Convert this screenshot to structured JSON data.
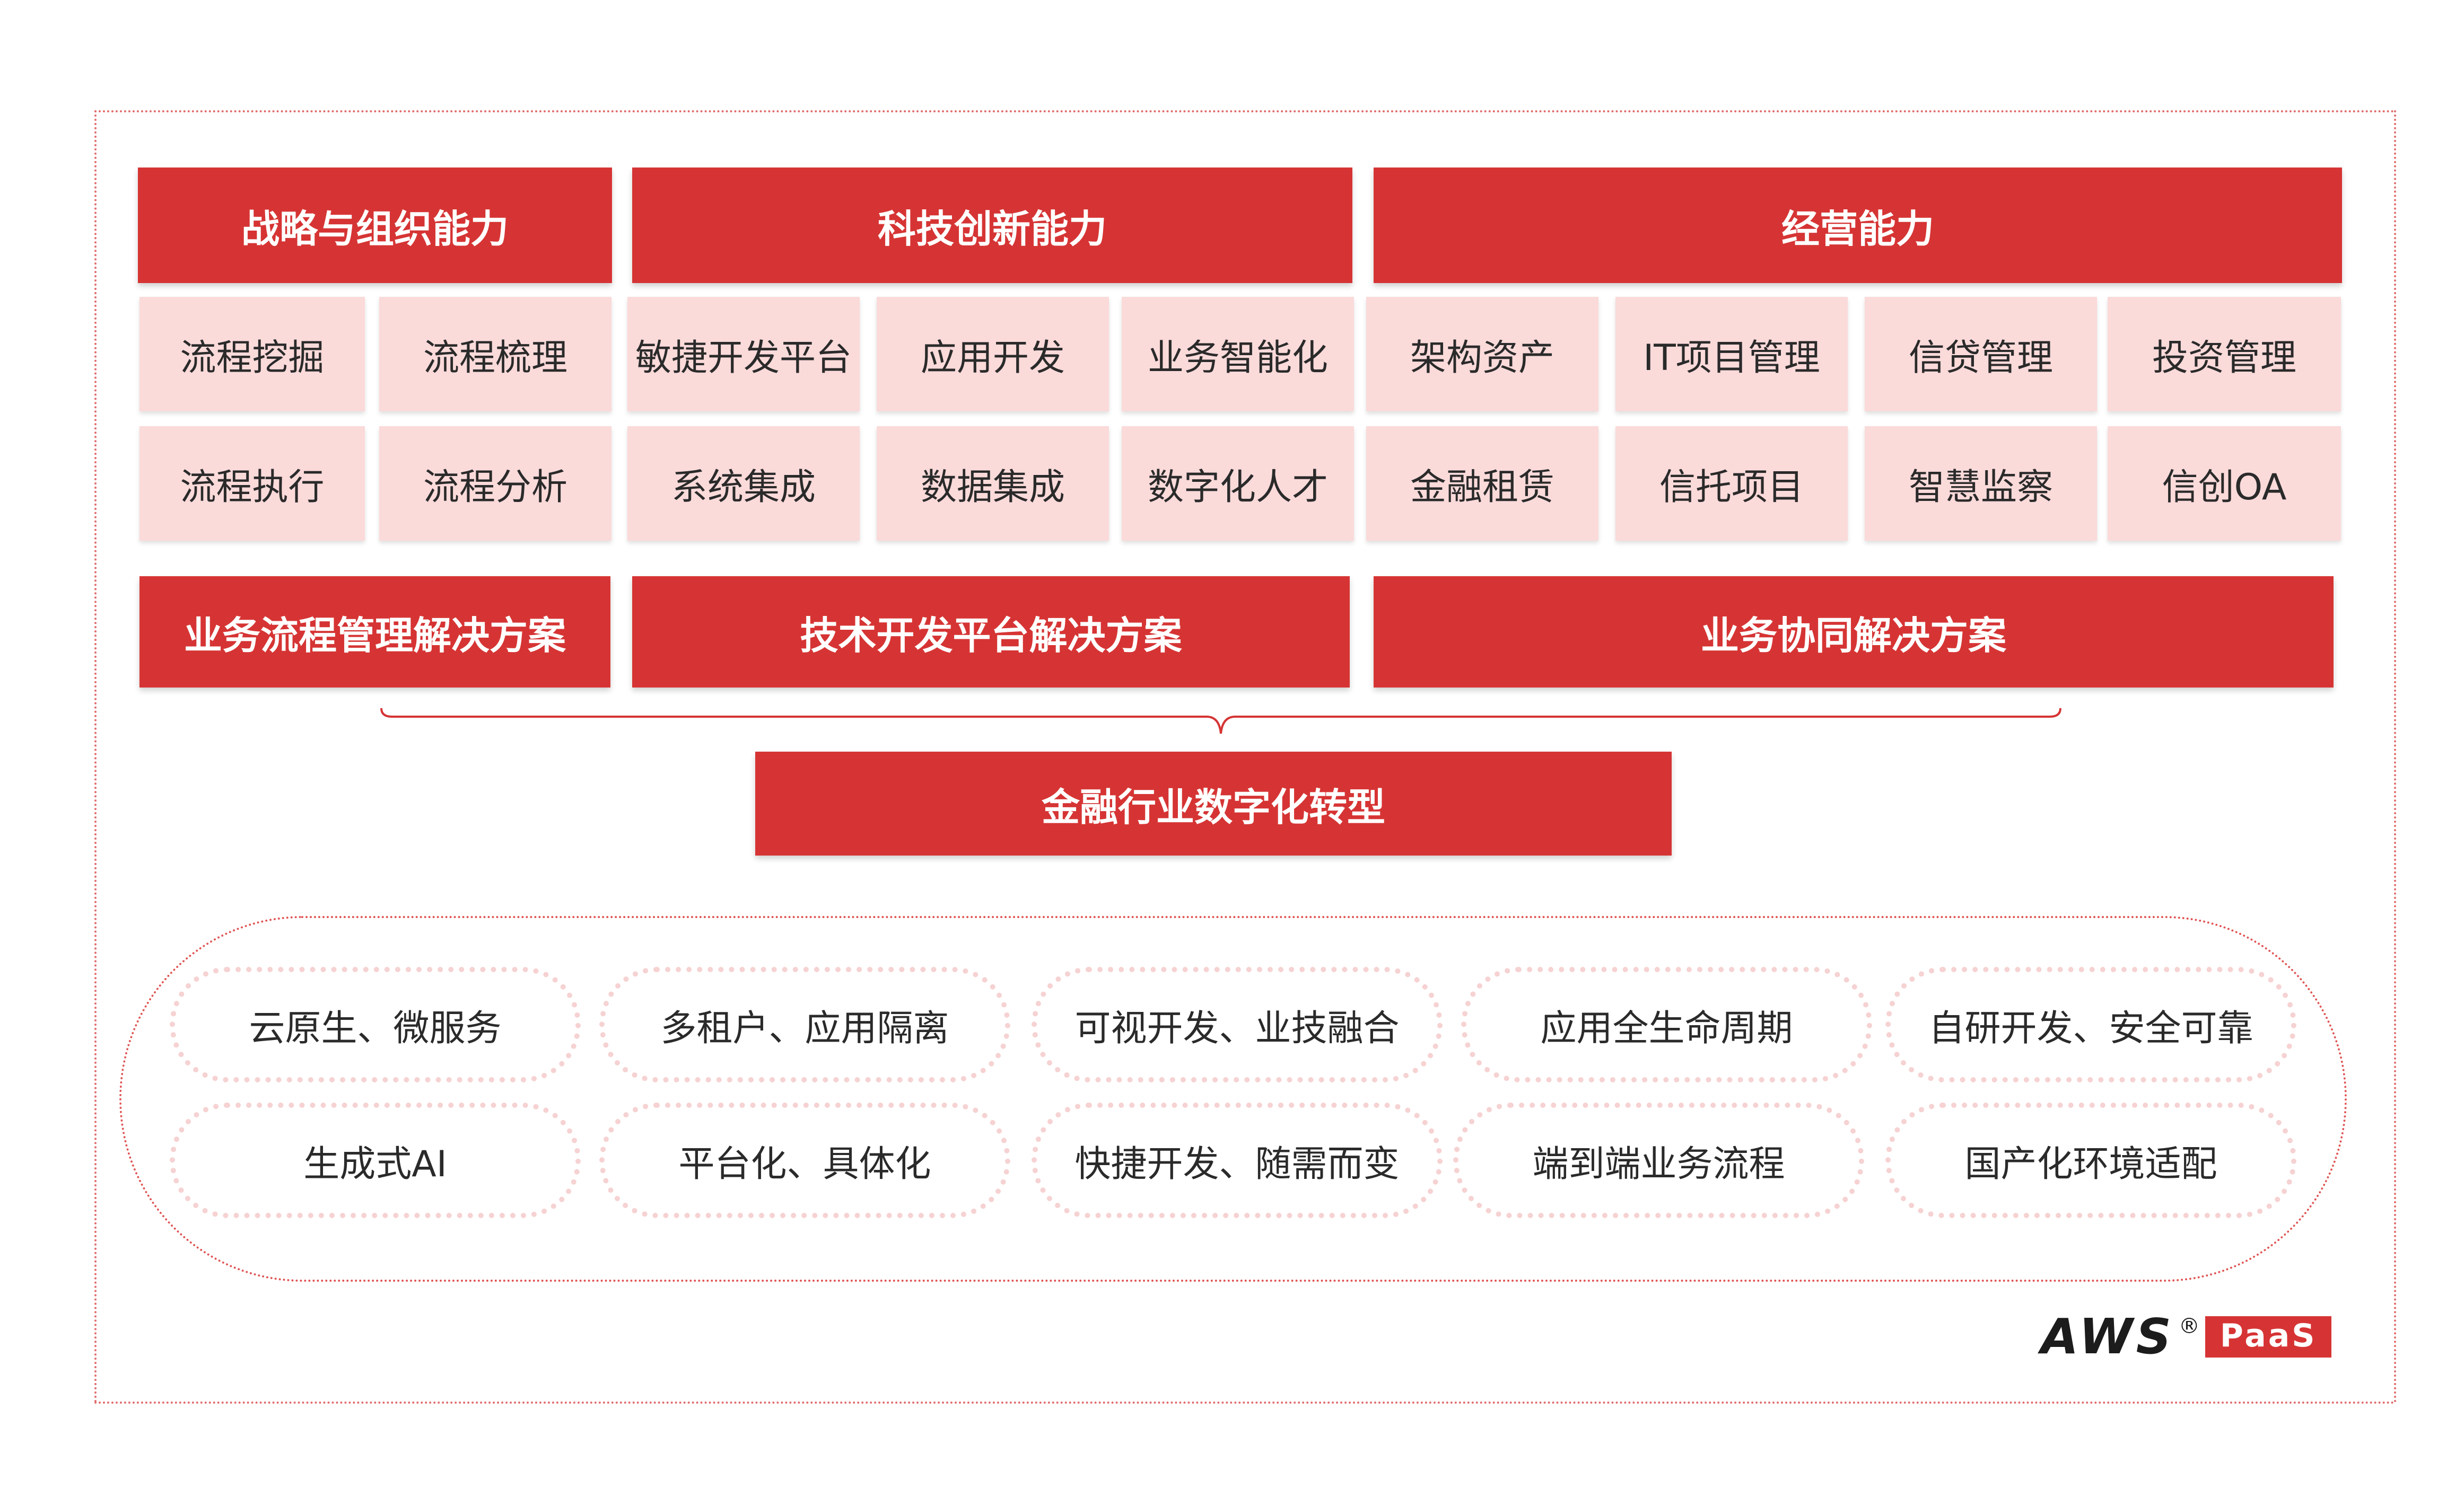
{
  "headers": [
    {
      "label": "战略与组织能力"
    },
    {
      "label": "科技创新能力"
    },
    {
      "label": "经营能力"
    }
  ],
  "items_row1": [
    {
      "label": "流程挖掘"
    },
    {
      "label": "流程梳理"
    },
    {
      "label": "敏捷开发平台"
    },
    {
      "label": "应用开发"
    },
    {
      "label": "业务智能化"
    },
    {
      "label": "架构资产"
    },
    {
      "label": "IT项目管理"
    },
    {
      "label": "信贷管理"
    },
    {
      "label": "投资管理"
    }
  ],
  "items_row2": [
    {
      "label": "流程执行"
    },
    {
      "label": "流程分析"
    },
    {
      "label": "系统集成"
    },
    {
      "label": "数据集成"
    },
    {
      "label": "数字化人才"
    },
    {
      "label": "金融租赁"
    },
    {
      "label": "信托项目"
    },
    {
      "label": "智慧监察"
    },
    {
      "label": "信创OA"
    }
  ],
  "solutions": [
    {
      "label": "业务流程管理解决方案"
    },
    {
      "label": "技术开发平台解决方案"
    },
    {
      "label": "业务协同解决方案"
    }
  ],
  "target": {
    "label": "金融行业数字化转型"
  },
  "features_row1": [
    {
      "label": "云原生、微服务"
    },
    {
      "label": "多租户、应用隔离"
    },
    {
      "label": "可视开发、业技融合"
    },
    {
      "label": "应用全生命周期"
    },
    {
      "label": "自研开发、安全可靠"
    }
  ],
  "features_row2": [
    {
      "label": "生成式AI"
    },
    {
      "label": "平台化、具体化"
    },
    {
      "label": "快捷开发、随需而变"
    },
    {
      "label": "端到端业务流程"
    },
    {
      "label": "国产化环境适配"
    }
  ],
  "logo": {
    "brand": "AWS",
    "reg": "®",
    "badge": "PaaS"
  },
  "colors": {
    "primary_red": "#d63434",
    "light_pink": "#fbdada",
    "dotted_border": "#e06d6d"
  }
}
